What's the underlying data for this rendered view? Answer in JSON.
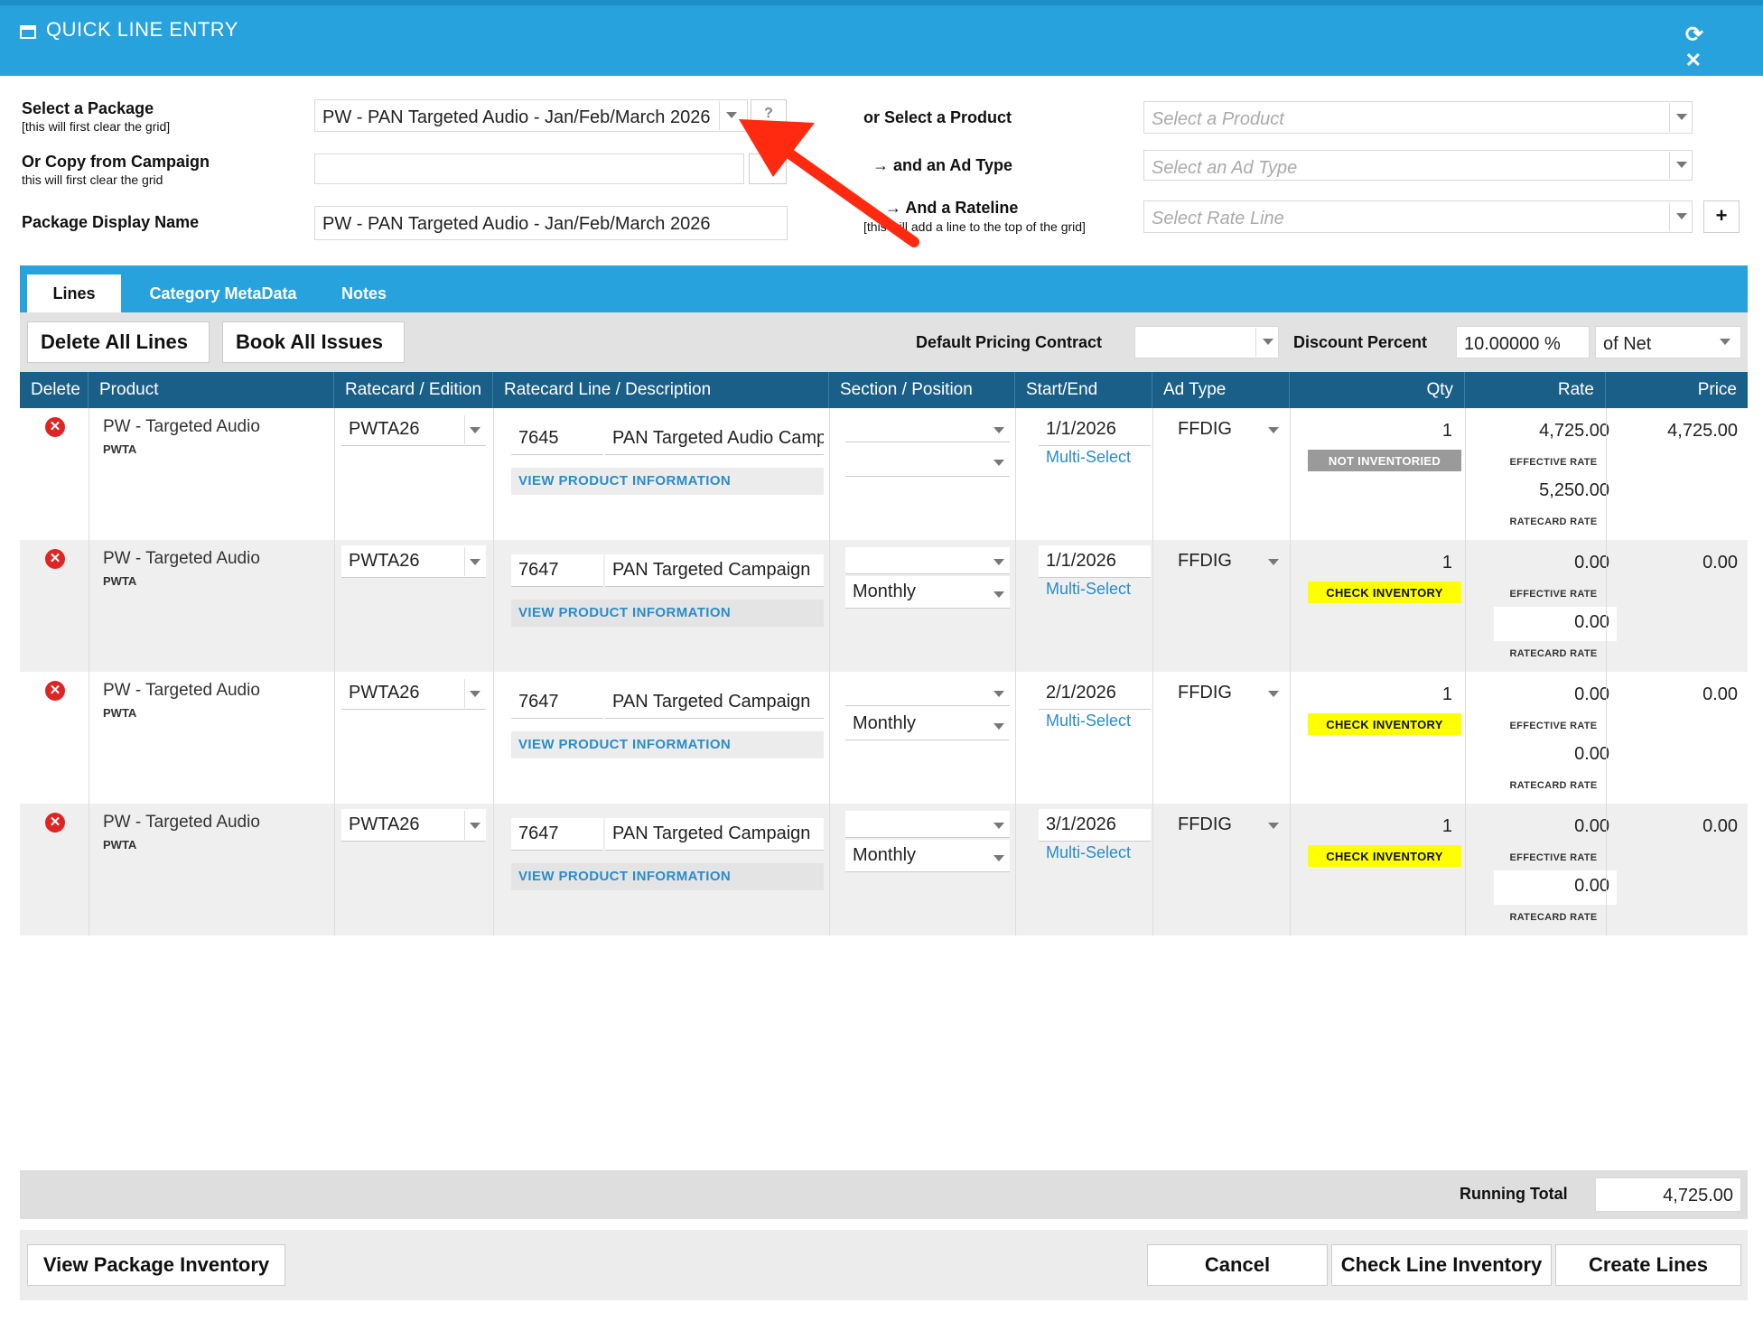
{
  "window": {
    "title": "QUICK LINE ENTRY"
  },
  "form": {
    "select_package_label": "Select a Package",
    "select_package_sub": "[this will first clear the grid]",
    "select_package_value": "PW - PAN Targeted Audio - Jan/Feb/March 2026",
    "package_help": "?",
    "copy_campaign_label": "Or Copy from Campaign",
    "copy_campaign_sub": "this will first clear the grid",
    "copy_campaign_value": "",
    "display_name_label": "Package Display Name",
    "display_name_value": "PW - PAN Targeted Audio - Jan/Feb/March 2026",
    "select_product_label": "or Select a Product",
    "select_product_placeholder": "Select a Product",
    "ad_type_label": "→ and an Ad Type",
    "ad_type_placeholder": "Select an Ad Type",
    "rateline_label": "→ And a Rateline",
    "rateline_sub": "[this will add a line to the top of the grid]",
    "rateline_placeholder": "Select Rate Line",
    "add_button": "+"
  },
  "tabs": [
    {
      "label": "Lines"
    },
    {
      "label": "Category MetaData"
    },
    {
      "label": "Notes"
    }
  ],
  "toolbar": {
    "delete_all": "Delete All Lines",
    "book_all": "Book All Issues",
    "pricing_contract_label": "Default Pricing Contract",
    "pricing_contract_value": "",
    "discount_label": "Discount Percent",
    "discount_value": "10.00000 %",
    "discount_basis": "of Net"
  },
  "columns": [
    "Delete",
    "Product",
    "Ratecard / Edition",
    "Ratecard Line / Description",
    "Section / Position",
    "Start/End",
    "Ad Type",
    "Qty",
    "Rate",
    "Price"
  ],
  "labels": {
    "multi_select": "Multi-Select",
    "view_product_info": "VIEW PRODUCT INFORMATION",
    "effective_rate": "EFFECTIVE RATE",
    "ratecard_rate": "RATECARD RATE"
  },
  "rows": [
    {
      "product": "PW - Targeted Audio",
      "code": "PWTA",
      "edition": "PWTA26",
      "line_id": "7645",
      "description": "PAN Targeted Audio Campaign",
      "section": "",
      "position": "",
      "start": "1/1/2026",
      "ad_type": "FFDIG",
      "qty": "1",
      "badge": "NOT INVENTORIED",
      "badge_color": "#9a9a9a",
      "effective_rate": "4,725.00",
      "ratecard_rate": "5,250.00",
      "price": "4,725.00"
    },
    {
      "product": "PW - Targeted Audio",
      "code": "PWTA",
      "edition": "PWTA26",
      "line_id": "7647",
      "description": "PAN Targeted Campaign",
      "section": "",
      "position": "Monthly",
      "start": "1/1/2026",
      "ad_type": "FFDIG",
      "qty": "1",
      "badge": "CHECK INVENTORY",
      "badge_color": "#ffff00",
      "effective_rate": "0.00",
      "ratecard_rate": "0.00",
      "price": "0.00"
    },
    {
      "product": "PW - Targeted Audio",
      "code": "PWTA",
      "edition": "PWTA26",
      "line_id": "7647",
      "description": "PAN Targeted Campaign",
      "section": "",
      "position": "Monthly",
      "start": "2/1/2026",
      "ad_type": "FFDIG",
      "qty": "1",
      "badge": "CHECK INVENTORY",
      "badge_color": "#ffff00",
      "effective_rate": "0.00",
      "ratecard_rate": "0.00",
      "price": "0.00"
    },
    {
      "product": "PW - Targeted Audio",
      "code": "PWTA",
      "edition": "PWTA26",
      "line_id": "7647",
      "description": "PAN Targeted Campaign",
      "section": "",
      "position": "Monthly",
      "start": "3/1/2026",
      "ad_type": "FFDIG",
      "qty": "1",
      "badge": "CHECK INVENTORY",
      "badge_color": "#ffff00",
      "effective_rate": "0.00",
      "ratecard_rate": "0.00",
      "price": "0.00"
    }
  ],
  "totals": {
    "label": "Running Total",
    "value": "4,725.00"
  },
  "footer": {
    "view_inventory": "View Package Inventory",
    "cancel": "Cancel",
    "check_inventory": "Check Line Inventory",
    "create_lines": "Create Lines"
  },
  "colors": {
    "header_blue": "#27a2dc",
    "grid_header": "#1a5f87",
    "link_blue": "#2a8cc7",
    "annotation_arrow": "#ff2a10"
  }
}
